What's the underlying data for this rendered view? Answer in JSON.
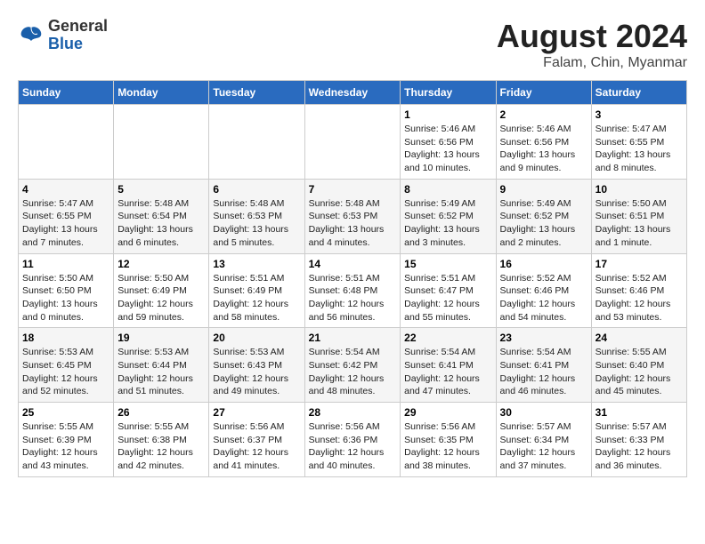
{
  "logo": {
    "line1": "General",
    "line2": "Blue"
  },
  "title": "August 2024",
  "subtitle": "Falam, Chin, Myanmar",
  "days_of_week": [
    "Sunday",
    "Monday",
    "Tuesday",
    "Wednesday",
    "Thursday",
    "Friday",
    "Saturday"
  ],
  "weeks": [
    [
      {
        "day": "",
        "info": ""
      },
      {
        "day": "",
        "info": ""
      },
      {
        "day": "",
        "info": ""
      },
      {
        "day": "",
        "info": ""
      },
      {
        "day": "1",
        "info": "Sunrise: 5:46 AM\nSunset: 6:56 PM\nDaylight: 13 hours and 10 minutes."
      },
      {
        "day": "2",
        "info": "Sunrise: 5:46 AM\nSunset: 6:56 PM\nDaylight: 13 hours and 9 minutes."
      },
      {
        "day": "3",
        "info": "Sunrise: 5:47 AM\nSunset: 6:55 PM\nDaylight: 13 hours and 8 minutes."
      }
    ],
    [
      {
        "day": "4",
        "info": "Sunrise: 5:47 AM\nSunset: 6:55 PM\nDaylight: 13 hours and 7 minutes."
      },
      {
        "day": "5",
        "info": "Sunrise: 5:48 AM\nSunset: 6:54 PM\nDaylight: 13 hours and 6 minutes."
      },
      {
        "day": "6",
        "info": "Sunrise: 5:48 AM\nSunset: 6:53 PM\nDaylight: 13 hours and 5 minutes."
      },
      {
        "day": "7",
        "info": "Sunrise: 5:48 AM\nSunset: 6:53 PM\nDaylight: 13 hours and 4 minutes."
      },
      {
        "day": "8",
        "info": "Sunrise: 5:49 AM\nSunset: 6:52 PM\nDaylight: 13 hours and 3 minutes."
      },
      {
        "day": "9",
        "info": "Sunrise: 5:49 AM\nSunset: 6:52 PM\nDaylight: 13 hours and 2 minutes."
      },
      {
        "day": "10",
        "info": "Sunrise: 5:50 AM\nSunset: 6:51 PM\nDaylight: 13 hours and 1 minute."
      }
    ],
    [
      {
        "day": "11",
        "info": "Sunrise: 5:50 AM\nSunset: 6:50 PM\nDaylight: 13 hours and 0 minutes."
      },
      {
        "day": "12",
        "info": "Sunrise: 5:50 AM\nSunset: 6:49 PM\nDaylight: 12 hours and 59 minutes."
      },
      {
        "day": "13",
        "info": "Sunrise: 5:51 AM\nSunset: 6:49 PM\nDaylight: 12 hours and 58 minutes."
      },
      {
        "day": "14",
        "info": "Sunrise: 5:51 AM\nSunset: 6:48 PM\nDaylight: 12 hours and 56 minutes."
      },
      {
        "day": "15",
        "info": "Sunrise: 5:51 AM\nSunset: 6:47 PM\nDaylight: 12 hours and 55 minutes."
      },
      {
        "day": "16",
        "info": "Sunrise: 5:52 AM\nSunset: 6:46 PM\nDaylight: 12 hours and 54 minutes."
      },
      {
        "day": "17",
        "info": "Sunrise: 5:52 AM\nSunset: 6:46 PM\nDaylight: 12 hours and 53 minutes."
      }
    ],
    [
      {
        "day": "18",
        "info": "Sunrise: 5:53 AM\nSunset: 6:45 PM\nDaylight: 12 hours and 52 minutes."
      },
      {
        "day": "19",
        "info": "Sunrise: 5:53 AM\nSunset: 6:44 PM\nDaylight: 12 hours and 51 minutes."
      },
      {
        "day": "20",
        "info": "Sunrise: 5:53 AM\nSunset: 6:43 PM\nDaylight: 12 hours and 49 minutes."
      },
      {
        "day": "21",
        "info": "Sunrise: 5:54 AM\nSunset: 6:42 PM\nDaylight: 12 hours and 48 minutes."
      },
      {
        "day": "22",
        "info": "Sunrise: 5:54 AM\nSunset: 6:41 PM\nDaylight: 12 hours and 47 minutes."
      },
      {
        "day": "23",
        "info": "Sunrise: 5:54 AM\nSunset: 6:41 PM\nDaylight: 12 hours and 46 minutes."
      },
      {
        "day": "24",
        "info": "Sunrise: 5:55 AM\nSunset: 6:40 PM\nDaylight: 12 hours and 45 minutes."
      }
    ],
    [
      {
        "day": "25",
        "info": "Sunrise: 5:55 AM\nSunset: 6:39 PM\nDaylight: 12 hours and 43 minutes."
      },
      {
        "day": "26",
        "info": "Sunrise: 5:55 AM\nSunset: 6:38 PM\nDaylight: 12 hours and 42 minutes."
      },
      {
        "day": "27",
        "info": "Sunrise: 5:56 AM\nSunset: 6:37 PM\nDaylight: 12 hours and 41 minutes."
      },
      {
        "day": "28",
        "info": "Sunrise: 5:56 AM\nSunset: 6:36 PM\nDaylight: 12 hours and 40 minutes."
      },
      {
        "day": "29",
        "info": "Sunrise: 5:56 AM\nSunset: 6:35 PM\nDaylight: 12 hours and 38 minutes."
      },
      {
        "day": "30",
        "info": "Sunrise: 5:57 AM\nSunset: 6:34 PM\nDaylight: 12 hours and 37 minutes."
      },
      {
        "day": "31",
        "info": "Sunrise: 5:57 AM\nSunset: 6:33 PM\nDaylight: 12 hours and 36 minutes."
      }
    ]
  ]
}
